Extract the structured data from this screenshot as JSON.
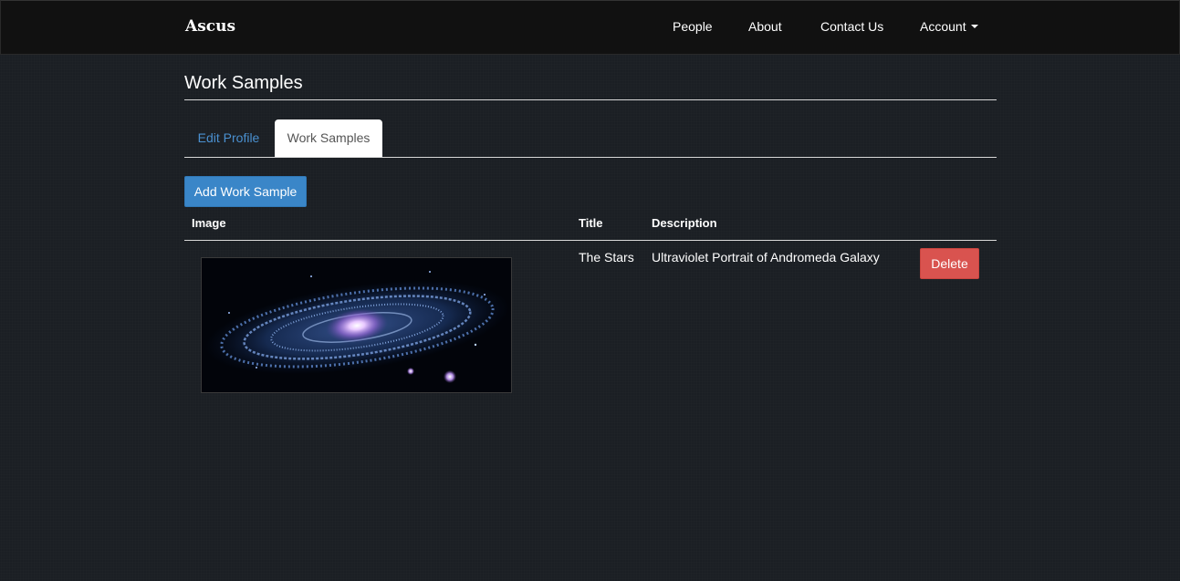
{
  "navbar": {
    "brand": "Ascus",
    "links": [
      "People",
      "About",
      "Contact Us",
      "Account"
    ]
  },
  "page": {
    "title": "Work Samples"
  },
  "tabs": [
    {
      "label": "Edit Profile",
      "active": false
    },
    {
      "label": "Work Samples",
      "active": true
    }
  ],
  "actions": {
    "add_label": "Add Work Sample"
  },
  "table": {
    "headers": [
      "Image",
      "Title",
      "Description"
    ],
    "rows": [
      {
        "image_icon": "galaxy-image",
        "title": "The Stars",
        "description": "Ultraviolet Portrait of Andromeda Galaxy",
        "delete_label": "Delete"
      }
    ]
  },
  "colors": {
    "background": "#1b1f24",
    "navbar": "#111111",
    "primary": "#3a86c8",
    "danger": "#d9534f",
    "link": "#4a90d0"
  }
}
